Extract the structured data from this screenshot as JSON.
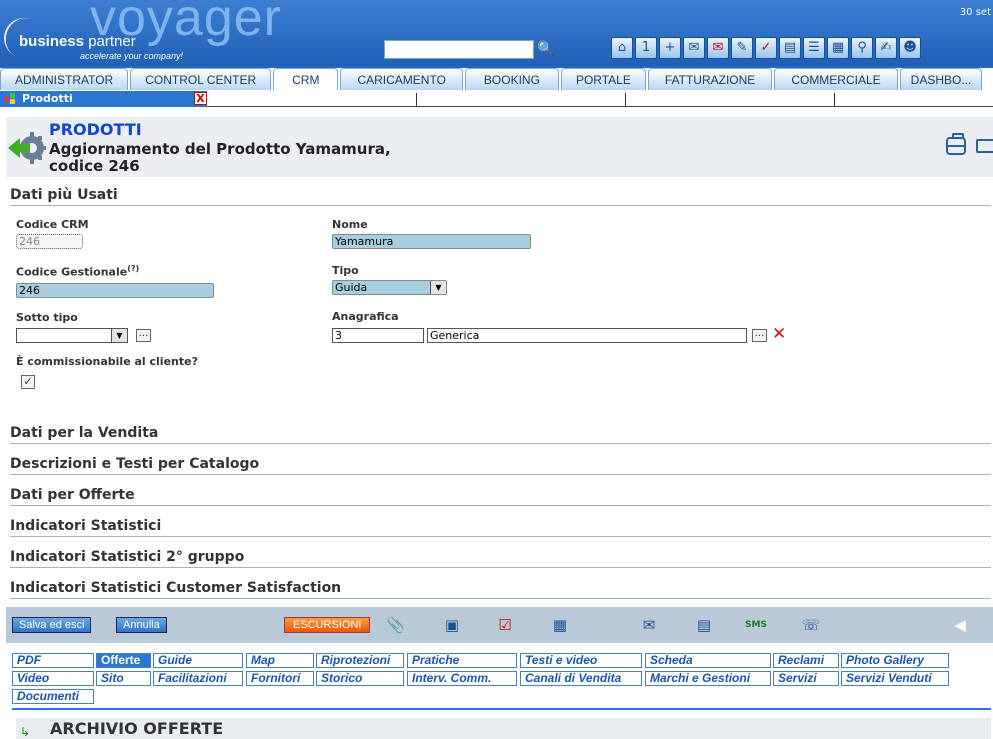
{
  "header": {
    "logo_main": "voyager",
    "logo_brand_bold": "business",
    "logo_brand_rest": " partner",
    "logo_tagline": "accelerate your company!",
    "date": "30 set",
    "search_value": "",
    "toolbar_icons": [
      "home-icon",
      "calendar-icon",
      "calendar-add-icon",
      "mail-open-icon",
      "mail-delete-icon",
      "pen-icon",
      "checklist-icon",
      "briefcase-icon",
      "list-icon",
      "calculator-icon",
      "search-icon",
      "note-edit-icon",
      "users-icon"
    ]
  },
  "menu": {
    "items": [
      "ADMINISTRATOR",
      "CONTROL CENTER",
      "CRM",
      "CARICAMENTO",
      "BOOKING",
      "PORTALE",
      "FATTURAZIONE",
      "COMMERCIALE",
      "DASHBO..."
    ],
    "active": "CRM"
  },
  "doctab": {
    "label": "Prodotti",
    "close": "X"
  },
  "title_panel": {
    "title": "PRODOTTI",
    "subtitle": "Aggiornamento del Prodotto Yamamura, codice 246"
  },
  "sections": {
    "main": "Dati più Usati",
    "collapsed": [
      "Dati per la Vendita",
      "Descrizioni e Testi per Catalogo",
      "Dati per Offerte",
      "Indicatori Statistici",
      "Indicatori Statistici 2° gruppo",
      "Indicatori Statistici Customer Satisfaction"
    ]
  },
  "fields": {
    "codice_crm": {
      "label": "Codice CRM",
      "value": "246"
    },
    "nome": {
      "label": "Nome",
      "value": "Yamamura"
    },
    "codice_gestionale": {
      "label": "Codice Gestionale",
      "sup": "(?)",
      "value": "246"
    },
    "tipo": {
      "label": "Tipo",
      "value": "Guida"
    },
    "sotto_tipo": {
      "label": "Sotto tipo",
      "value": ""
    },
    "anagrafica": {
      "label": "Anagrafica",
      "code": "3",
      "name": "Generica"
    },
    "commissionabile": {
      "label": "È commissionabile al cliente?",
      "checked": "✓"
    }
  },
  "actionbar": {
    "save_label": "Salva ed esci",
    "cancel_label": "Annulla",
    "escursioni_label": "ESCURSIONI",
    "sms_label": "SMS"
  },
  "subtabs": {
    "row1": [
      "PDF",
      "Offerte",
      "Guide",
      "Map",
      "Riprotezioni",
      "Pratiche",
      "Testi e video",
      "Scheda",
      "Reclami",
      "Photo Gallery"
    ],
    "row2": [
      "Video",
      "Sito",
      "Facilitazioni",
      "Fornitori",
      "Storico",
      "Interv. Comm.",
      "Canali di Vendita",
      "Marchi e Gestioni",
      "Servizi",
      "Servizi Venduti"
    ],
    "row3": [
      "Documenti"
    ],
    "active": "Offerte"
  },
  "archivio": {
    "title": "ARCHIVIO OFFERTE"
  }
}
